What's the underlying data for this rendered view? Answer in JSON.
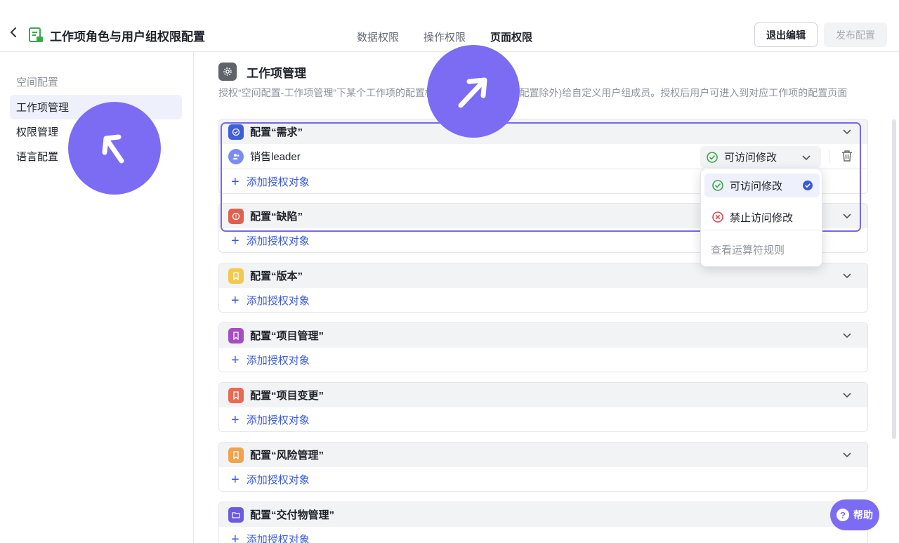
{
  "header": {
    "title": "工作项角色与用户组权限配置",
    "tabs": [
      {
        "label": "数据权限"
      },
      {
        "label": "操作权限"
      },
      {
        "label": "页面权限"
      }
    ],
    "exit_label": "退出编辑",
    "publish_label": "发布配置"
  },
  "sidebar": {
    "group_label": "空间配置",
    "items": [
      {
        "label": "工作项管理"
      },
      {
        "label": "权限管理"
      },
      {
        "label": "语言配置"
      }
    ]
  },
  "main": {
    "title": "工作项管理",
    "description": "授权“空间配置-工作项管理”下某个工作项的配置权限(角色/流程的权限配置除外)给自定义用户组成员。授权后用户可进入到对应工作项的配置页面",
    "add_label": "添加授权对象",
    "cards": [
      {
        "title": "配置“需求”",
        "color": "#3e5fd8",
        "icon": "check-circle-icon",
        "member": "销售leader",
        "permission": "可访问修改"
      },
      {
        "title": "配置“缺陷”",
        "color": "#e0604f",
        "icon": "alert-circle-icon"
      },
      {
        "title": "配置“版本”",
        "color": "#f2c94c",
        "icon": "bookmark-icon"
      },
      {
        "title": "配置“项目管理”",
        "color": "#a64cc2",
        "icon": "bookmark-icon"
      },
      {
        "title": "配置“项目变更”",
        "color": "#e76a52",
        "icon": "bookmark-icon"
      },
      {
        "title": "配置“风险管理”",
        "color": "#f0a34a",
        "icon": "bookmark-icon"
      },
      {
        "title": "配置“交付物管理”",
        "color": "#6a5ae0",
        "icon": "folder-icon"
      }
    ]
  },
  "dropdown": {
    "options": [
      {
        "label": "可访问修改",
        "selected": true
      },
      {
        "label": "禁止访问修改",
        "selected": false
      }
    ],
    "link_label": "查看运算符规则"
  },
  "help_label": "帮助",
  "colors": {
    "accent": "#7c6cf4",
    "link": "#3b5bdb",
    "success": "#3aa94b",
    "danger": "#e5484d"
  }
}
